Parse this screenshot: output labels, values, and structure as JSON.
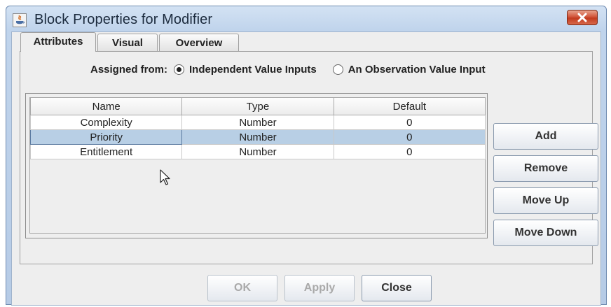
{
  "window": {
    "title": "Block Properties for Modifier",
    "icon": "java-app-icon"
  },
  "tabs": [
    {
      "label": "Attributes",
      "active": true
    },
    {
      "label": "Visual",
      "active": false
    },
    {
      "label": "Overview",
      "active": false
    }
  ],
  "assigned": {
    "label": "Assigned from:",
    "options": [
      {
        "label": "Independent Value Inputs",
        "selected": true
      },
      {
        "label": "An Observation Value Input",
        "selected": false
      }
    ]
  },
  "table": {
    "columns": [
      "Name",
      "Type",
      "Default"
    ],
    "rows": [
      {
        "name": "Complexity",
        "type": "Number",
        "default": "0"
      },
      {
        "name": "Priority",
        "type": "Number",
        "default": "0"
      },
      {
        "name": "Entitlement",
        "type": "Number",
        "default": "0"
      }
    ],
    "selected_row": "Priority"
  },
  "side_buttons": {
    "add": "Add",
    "remove": "Remove",
    "move_up": "Move Up",
    "move_down": "Move Down"
  },
  "bottom_buttons": {
    "ok": "OK",
    "apply": "Apply",
    "close": "Close"
  },
  "colors": {
    "title_bar": "#c0d4ec",
    "close_button": "#c94a2e",
    "selection": "#b8cfe5"
  }
}
